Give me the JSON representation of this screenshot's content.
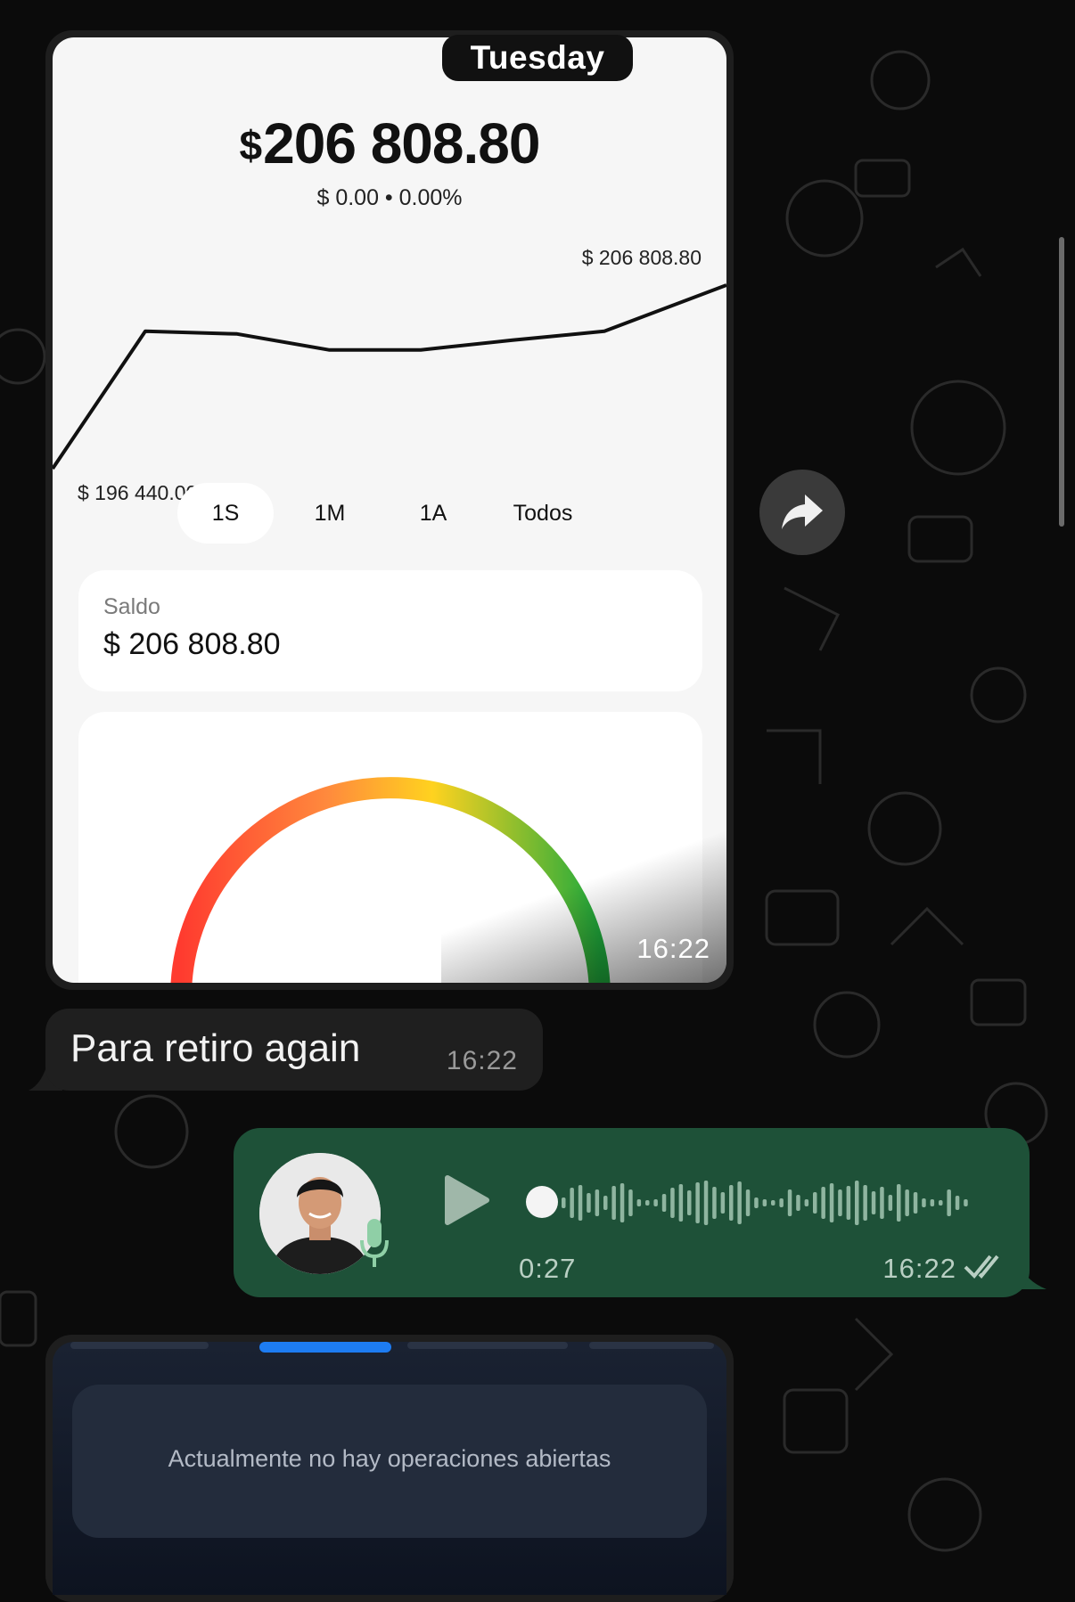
{
  "image_message": {
    "day_label": "Tuesday",
    "total_currency": "$",
    "total_value": "206 808.80",
    "change_text": "$ 0.00 • 0.00%",
    "chart_max_label": "$ 206 808.80",
    "chart_min_label": "$ 196 440.00",
    "chart_values": [
      196440.0,
      204200,
      204050,
      203150,
      203150,
      203700,
      204200,
      206808.8
    ],
    "tabs": [
      {
        "label": "1S",
        "active": true
      },
      {
        "label": "1M",
        "active": false
      },
      {
        "label": "1A",
        "active": false
      },
      {
        "label": "Todos",
        "active": false
      }
    ],
    "balance_label": "Saldo",
    "balance_value": "$ 206 808.80",
    "time": "16:22"
  },
  "text_message": {
    "text": "Para retiro again",
    "time": "16:22"
  },
  "voice_message": {
    "duration": "0:27",
    "time": "16:22"
  },
  "image_message_2": {
    "text": "Actualmente no hay operaciones abiertas"
  },
  "colors": {
    "outgoing_bubble": "#1e5138",
    "incoming_bubble": "#1f1f1f",
    "gauge_start": "#ff3b2f",
    "gauge_mid": "#ffd21f",
    "gauge_end": "#1faa3c"
  },
  "icons": [
    "forward-icon",
    "play-icon",
    "mic-icon",
    "double-check-icon"
  ]
}
